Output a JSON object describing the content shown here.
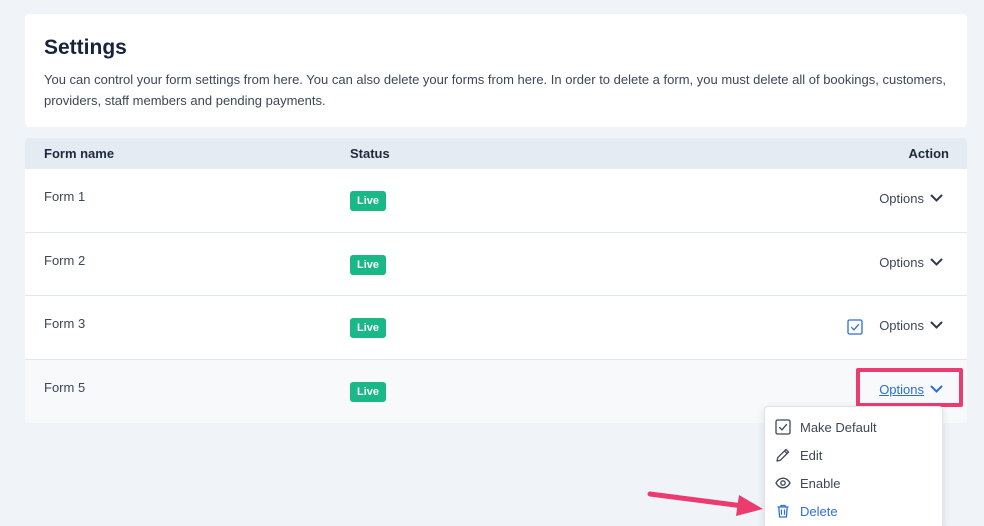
{
  "header": {
    "title": "Settings",
    "description": "You can control your form settings from here. You can also delete your forms from here. In order to delete a form, you must delete all of bookings, customers, providers, staff members and pending payments."
  },
  "table": {
    "columns": {
      "name": "Form name",
      "status": "Status",
      "action": "Action"
    },
    "rows": [
      {
        "name": "Form 1",
        "status": "Live",
        "action": "Options"
      },
      {
        "name": "Form 2",
        "status": "Live",
        "action": "Options"
      },
      {
        "name": "Form 3",
        "status": "Live",
        "action": "Options"
      },
      {
        "name": "Form 5",
        "status": "Live",
        "action": "Options"
      }
    ]
  },
  "dropdown": {
    "items": [
      {
        "label": "Make Default",
        "icon": "checkbox-icon"
      },
      {
        "label": "Edit",
        "icon": "pencil-icon"
      },
      {
        "label": "Enable",
        "icon": "eye-icon"
      },
      {
        "label": "Delete",
        "icon": "trash-icon"
      }
    ]
  },
  "colors": {
    "badge": "#19b886",
    "link": "#2b6fd6",
    "highlight": "#ec3b6e",
    "background": "#f0f4f9"
  }
}
